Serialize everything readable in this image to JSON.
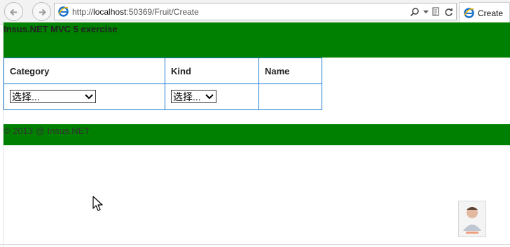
{
  "browser": {
    "address": {
      "prefix": "http://",
      "host": "localhost",
      "rest": ":50369/Fruit/Create"
    },
    "tab": {
      "title": "Create"
    },
    "icons": [
      "back-icon",
      "forward-icon",
      "ie-icon",
      "search-icon",
      "dropdown-icon",
      "compatibility-icon",
      "refresh-icon"
    ]
  },
  "page": {
    "header_title": "Insus.NET MVC 5 exercise",
    "form": {
      "columns": [
        "Category",
        "Kind",
        "Name"
      ],
      "category_select": {
        "selected": "选择..."
      },
      "kind_select": {
        "selected": "选择..."
      }
    },
    "footer_text": "© 2013 @ Insus.NET"
  },
  "colors": {
    "header_bg": "#008000",
    "table_border": "#1e7bd0"
  }
}
